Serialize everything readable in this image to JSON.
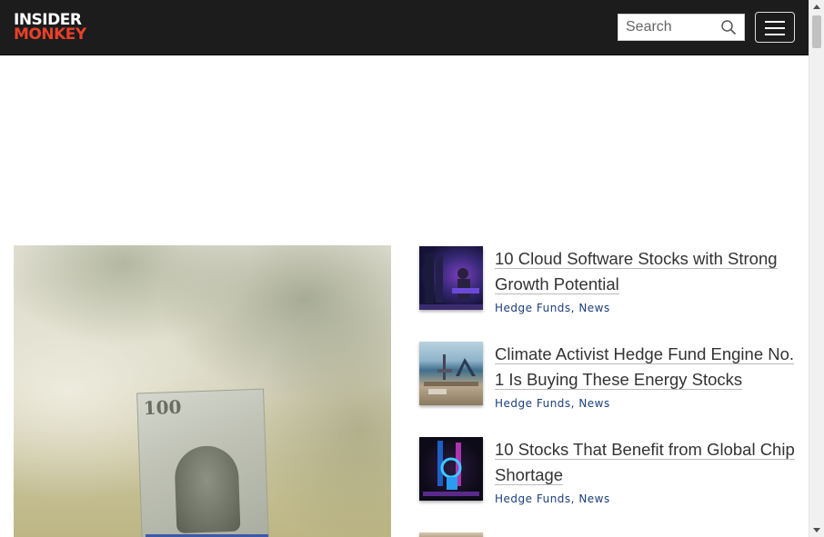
{
  "header": {
    "logo_top": "INSIDER",
    "logo_bottom": "MONKEY",
    "search_placeholder": "Search",
    "accent_color": "#e8402a",
    "background_color": "#1c1c1c"
  },
  "articles": [
    {
      "title": "10 Cloud Software Stocks with Strong Growth Potential",
      "categories": [
        "Hedge Funds",
        "News"
      ],
      "separator": ", "
    },
    {
      "title": "Climate Activist Hedge Fund Engine No. 1 Is Buying These Energy Stocks",
      "categories": [
        "Hedge Funds",
        "News"
      ],
      "separator": ", "
    },
    {
      "title": "10 Stocks That Benefit from Global Chip Shortage",
      "categories": [
        "Hedge Funds",
        "News"
      ],
      "separator": ", "
    }
  ],
  "icons": {
    "search": "search-icon",
    "menu": "hamburger-menu-icon"
  }
}
